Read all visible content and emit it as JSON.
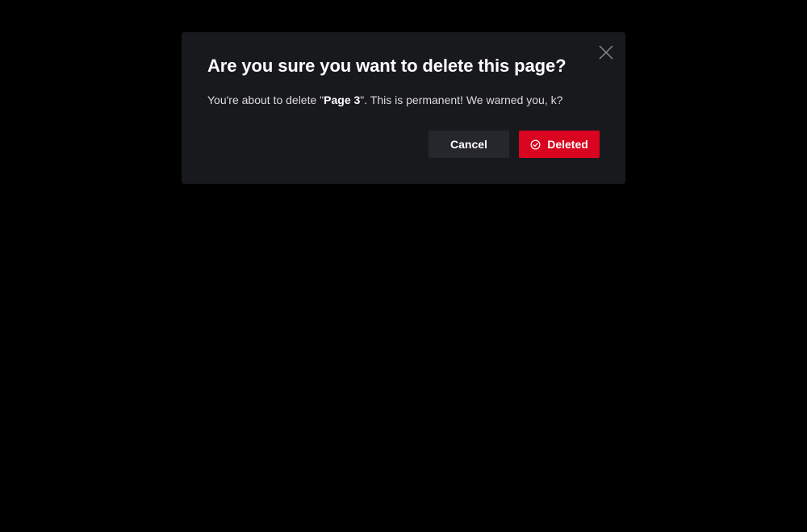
{
  "dialog": {
    "title": "Are you sure you want to delete this page?",
    "message_prefix": "You're about to delete \"",
    "page_name": "Page 3",
    "message_suffix": "\". This is permanent! We warned you, k?",
    "cancel_label": "Cancel",
    "delete_label": "Deleted",
    "close_icon": "close-icon",
    "delete_icon": "check-circle-icon"
  },
  "colors": {
    "backdrop": "#000000",
    "dialog_bg": "#18191d",
    "cancel_bg": "#26272c",
    "danger": "#d9041f",
    "text": "#ffffff"
  }
}
